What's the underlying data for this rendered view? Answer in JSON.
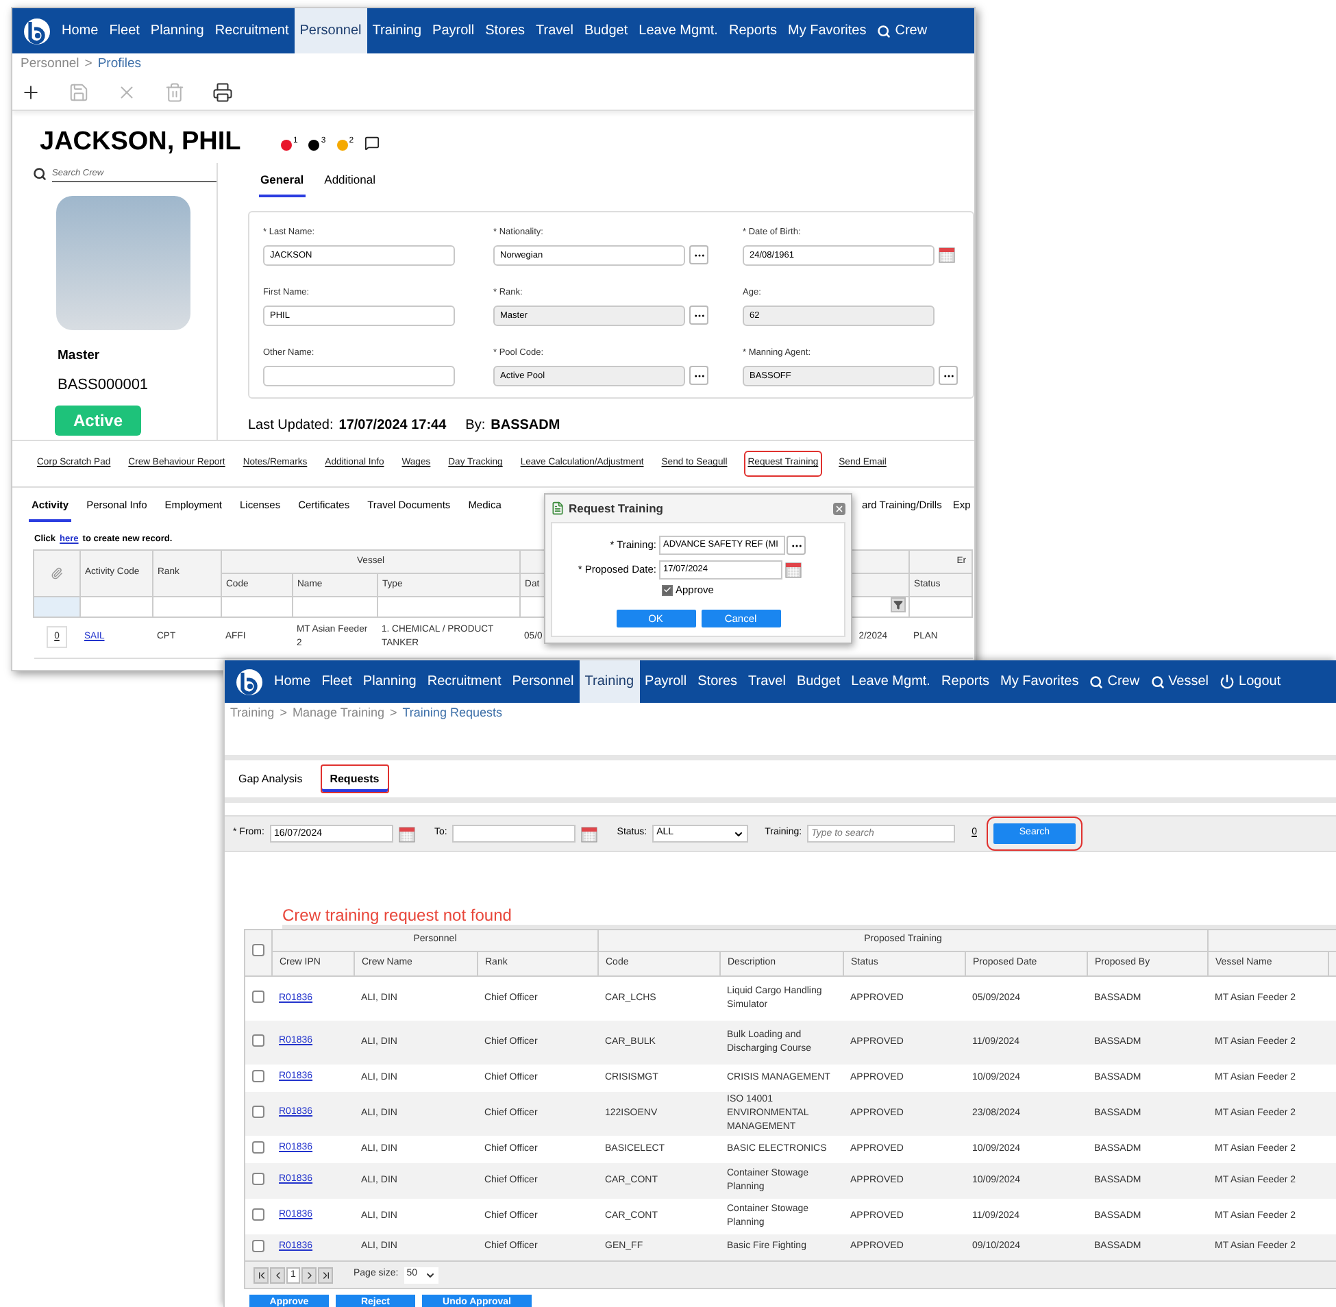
{
  "profile_window": {
    "nav": [
      {
        "kind": "link",
        "label": "Home",
        "selected": false
      },
      {
        "kind": "link",
        "label": "Fleet",
        "selected": false
      },
      {
        "kind": "link",
        "label": "Planning",
        "selected": false
      },
      {
        "kind": "link",
        "label": "Recruitment",
        "selected": false
      },
      {
        "kind": "link",
        "label": "Personnel",
        "selected": true
      },
      {
        "kind": "link",
        "label": "Training",
        "selected": false
      },
      {
        "kind": "link",
        "label": "Payroll",
        "selected": false
      },
      {
        "kind": "link",
        "label": "Stores",
        "selected": false
      },
      {
        "kind": "link",
        "label": "Travel",
        "selected": false
      },
      {
        "kind": "link",
        "label": "Budget",
        "selected": false
      },
      {
        "kind": "link",
        "label": "Leave Mgmt.",
        "selected": false
      },
      {
        "kind": "link",
        "label": "Reports",
        "selected": false
      },
      {
        "kind": "link",
        "label": "My Favorites",
        "selected": false
      },
      {
        "kind": "search",
        "label": "Crew",
        "selected": false
      }
    ],
    "breadcrumb": [
      "Personnel",
      "Profiles"
    ],
    "breadcrumb_separator": ">",
    "toolbar": [
      {
        "kind": "add",
        "disabled": false
      },
      {
        "kind": "save",
        "disabled": true
      },
      {
        "kind": "close",
        "disabled": true
      },
      {
        "kind": "delete",
        "disabled": true
      },
      {
        "kind": "print",
        "disabled": false
      }
    ],
    "name": "JACKSON, PHIL",
    "indicators": [
      {
        "color": "#e8162c",
        "count": "1"
      },
      {
        "color": "#000000",
        "count": "3"
      },
      {
        "color": "#f5a900",
        "count": "2"
      }
    ],
    "search_placeholder": "Search Crew",
    "rank": "Master",
    "code": "BASS000001",
    "status": "Active",
    "tabs": [
      {
        "label": "General",
        "selected": true
      },
      {
        "label": "Additional",
        "selected": false
      }
    ],
    "fields": [
      {
        "kind": "text",
        "label": "* Last Name:",
        "value": "JACKSON",
        "readonly": false
      },
      {
        "kind": "lookup",
        "label": "* Nationality:",
        "value": "Norwegian",
        "readonly": false
      },
      {
        "kind": "date",
        "label": "* Date of Birth:",
        "value": "24/08/1961",
        "readonly": false
      },
      {
        "kind": "text",
        "label": "First Name:",
        "value": "PHIL",
        "readonly": false
      },
      {
        "kind": "lookup",
        "label": "* Rank:",
        "value": "Master",
        "readonly": true
      },
      {
        "kind": "text",
        "label": "Age:",
        "value": "62",
        "readonly": true
      },
      {
        "kind": "text",
        "label": "Other Name:",
        "readonly": false
      },
      {
        "kind": "lookup",
        "label": "* Pool Code:",
        "value": "Active Pool",
        "readonly": true
      },
      {
        "kind": "lookup",
        "label": "* Manning Agent:",
        "value": "BASSOFF",
        "readonly": true
      }
    ],
    "last_updated_label": "Last Updated:",
    "last_updated": "17/07/2024 17:44",
    "by_label": "By:",
    "by": "BASSADM",
    "links": [
      {
        "label": "Corp Scratch Pad",
        "highlighted": false
      },
      {
        "label": "Crew Behaviour Report",
        "highlighted": false
      },
      {
        "label": "Notes/Remarks",
        "highlighted": false
      },
      {
        "label": "Additional Info",
        "highlighted": false
      },
      {
        "label": "Wages",
        "highlighted": false
      },
      {
        "label": "Day Tracking",
        "highlighted": false
      },
      {
        "label": "Leave Calculation/Adjustment",
        "highlighted": false
      },
      {
        "label": "Send to Seagull",
        "highlighted": false
      },
      {
        "label": "Request Training",
        "highlighted": true
      },
      {
        "label": "Send Email",
        "highlighted": false
      }
    ],
    "record_tabs": [
      {
        "label": "Activity",
        "selected": true
      },
      {
        "label": "Personal Info",
        "selected": false
      },
      {
        "label": "Employment",
        "selected": false
      },
      {
        "label": "Licenses",
        "selected": false
      },
      {
        "label": "Certificates",
        "selected": false
      },
      {
        "label": "Travel Documents",
        "selected": false
      },
      {
        "label": "Medica",
        "selected": false
      },
      {
        "label": "ard Training/Drills",
        "selected": false
      },
      {
        "label": "Exp",
        "selected": false
      }
    ],
    "create_hint": {
      "before": "Click",
      "link": "here",
      "after": "to create new record."
    },
    "table": {
      "activity_code": "Activity Code",
      "rank": "Rank",
      "vessel": "Vessel",
      "code": "Code",
      "name": "Name",
      "type": "Type",
      "date": "Dat",
      "status": "Status",
      "end_group": "Er",
      "rows": [
        {
          "count": "0",
          "activity_code": "SAIL",
          "rank": "CPT",
          "code": "AFFI",
          "name": "MT Asian Feeder 2",
          "type": "1. CHEMICAL / PRODUCT TANKER",
          "date": "05/0",
          "end_date": "2/2024",
          "status": "PLAN"
        }
      ]
    }
  },
  "dialog": {
    "title": "Request Training",
    "training_label": "* Training:",
    "training_value": "ADVANCE SAFETY REF (MI",
    "date_label": "* Proposed Date:",
    "date_value": "17/07/2024",
    "approve_label": "Approve",
    "approve_checked": true,
    "buttons": [
      "OK",
      "Cancel"
    ]
  },
  "requests_window": {
    "nav": [
      {
        "kind": "link",
        "label": "Home",
        "selected": false
      },
      {
        "kind": "link",
        "label": "Fleet",
        "selected": false
      },
      {
        "kind": "link",
        "label": "Planning",
        "selected": false
      },
      {
        "kind": "link",
        "label": "Recruitment",
        "selected": false
      },
      {
        "kind": "link",
        "label": "Personnel",
        "selected": false
      },
      {
        "kind": "link",
        "label": "Training",
        "selected": true
      },
      {
        "kind": "link",
        "label": "Payroll",
        "selected": false
      },
      {
        "kind": "link",
        "label": "Stores",
        "selected": false
      },
      {
        "kind": "link",
        "label": "Travel",
        "selected": false
      },
      {
        "kind": "link",
        "label": "Budget",
        "selected": false
      },
      {
        "kind": "link",
        "label": "Leave Mgmt.",
        "selected": false
      },
      {
        "kind": "link",
        "label": "Reports",
        "selected": false
      },
      {
        "kind": "link",
        "label": "My Favorites",
        "selected": false
      },
      {
        "kind": "search",
        "label": "Crew",
        "selected": false
      },
      {
        "kind": "search",
        "label": "Vessel",
        "selected": false
      },
      {
        "kind": "logout",
        "label": "Logout",
        "selected": false
      }
    ],
    "breadcrumb": [
      "Training",
      "Manage Training",
      "Training Requests"
    ],
    "breadcrumb_separators": [
      ">",
      ">"
    ],
    "tabs": [
      {
        "label": "Gap Analysis",
        "selected": false,
        "highlighted": false
      },
      {
        "label": "Requests",
        "selected": true,
        "highlighted": true
      }
    ],
    "filters": {
      "from_label": "* From:",
      "from": "16/07/2024",
      "to_label": "To:",
      "status_label": "Status:",
      "status": "ALL",
      "training_label": "Training:",
      "training_placeholder": "Type to search",
      "clear": "0",
      "search": "Search",
      "search_highlighted": true
    },
    "message": "Crew training request not found",
    "table": {
      "select_all_checked": false,
      "groups": [
        {
          "label": "Personnel",
          "columns": [
            "Crew IPN",
            "Crew Name",
            "Rank"
          ]
        },
        {
          "label": "Proposed Training",
          "columns": [
            "Code",
            "Description",
            "Status",
            "Proposed Date",
            "Proposed By"
          ]
        },
        {
          "columns": [
            "Vessel Name"
          ]
        }
      ],
      "rows": [
        {
          "checked": false,
          "crew_ipn": "R01836",
          "crew_name": "ALI, DIN",
          "rank": "Chief Officer",
          "code": "CAR_LCHS",
          "description": "Liquid Cargo Handling Simulator",
          "status": "APPROVED",
          "proposed_date": "05/09/2024",
          "proposed_by": "BASSADM",
          "vessel_name": "MT Asian Feeder 2"
        },
        {
          "checked": false,
          "crew_ipn": "R01836",
          "crew_name": "ALI, DIN",
          "rank": "Chief Officer",
          "code": "CAR_BULK",
          "description": "Bulk Loading and Discharging Course",
          "status": "APPROVED",
          "proposed_date": "11/09/2024",
          "proposed_by": "BASSADM",
          "vessel_name": "MT Asian Feeder 2"
        },
        {
          "checked": false,
          "crew_ipn": "R01836",
          "crew_name": "ALI, DIN",
          "rank": "Chief Officer",
          "code": "CRISISMGT",
          "description": "CRISIS MANAGEMENT",
          "status": "APPROVED",
          "proposed_date": "10/09/2024",
          "proposed_by": "BASSADM",
          "vessel_name": "MT Asian Feeder 2"
        },
        {
          "checked": false,
          "crew_ipn": "R01836",
          "crew_name": "ALI, DIN",
          "rank": "Chief Officer",
          "code": "122ISOENV",
          "description": "ISO 14001 ENVIRONMENTAL MANAGEMENT",
          "status": "APPROVED",
          "proposed_date": "23/08/2024",
          "proposed_by": "BASSADM",
          "vessel_name": "MT Asian Feeder 2"
        },
        {
          "checked": false,
          "crew_ipn": "R01836",
          "crew_name": "ALI, DIN",
          "rank": "Chief Officer",
          "code": "BASICELECT",
          "description": "BASIC ELECTRONICS",
          "status": "APPROVED",
          "proposed_date": "10/09/2024",
          "proposed_by": "BASSADM",
          "vessel_name": "MT Asian Feeder 2"
        },
        {
          "checked": false,
          "crew_ipn": "R01836",
          "crew_name": "ALI, DIN",
          "rank": "Chief Officer",
          "code": "CAR_CONT",
          "description": "Container Stowage Planning",
          "status": "APPROVED",
          "proposed_date": "10/09/2024",
          "proposed_by": "BASSADM",
          "vessel_name": "MT Asian Feeder 2"
        },
        {
          "checked": false,
          "crew_ipn": "R01836",
          "crew_name": "ALI, DIN",
          "rank": "Chief Officer",
          "code": "CAR_CONT",
          "description": "Container Stowage Planning",
          "status": "APPROVED",
          "proposed_date": "11/09/2024",
          "proposed_by": "BASSADM",
          "vessel_name": "MT Asian Feeder 2"
        },
        {
          "checked": false,
          "crew_ipn": "R01836",
          "crew_name": "ALI, DIN",
          "rank": "Chief Officer",
          "code": "GEN_FF",
          "description": "Basic Fire Fighting",
          "status": "APPROVED",
          "proposed_date": "09/10/2024",
          "proposed_by": "BASSADM",
          "vessel_name": "MT Asian Feeder 2"
        }
      ],
      "page": "1",
      "page_size_label": "Page size:",
      "page_size": "50"
    },
    "actions": [
      "Approve",
      "Reject",
      "Undo Approval"
    ]
  }
}
